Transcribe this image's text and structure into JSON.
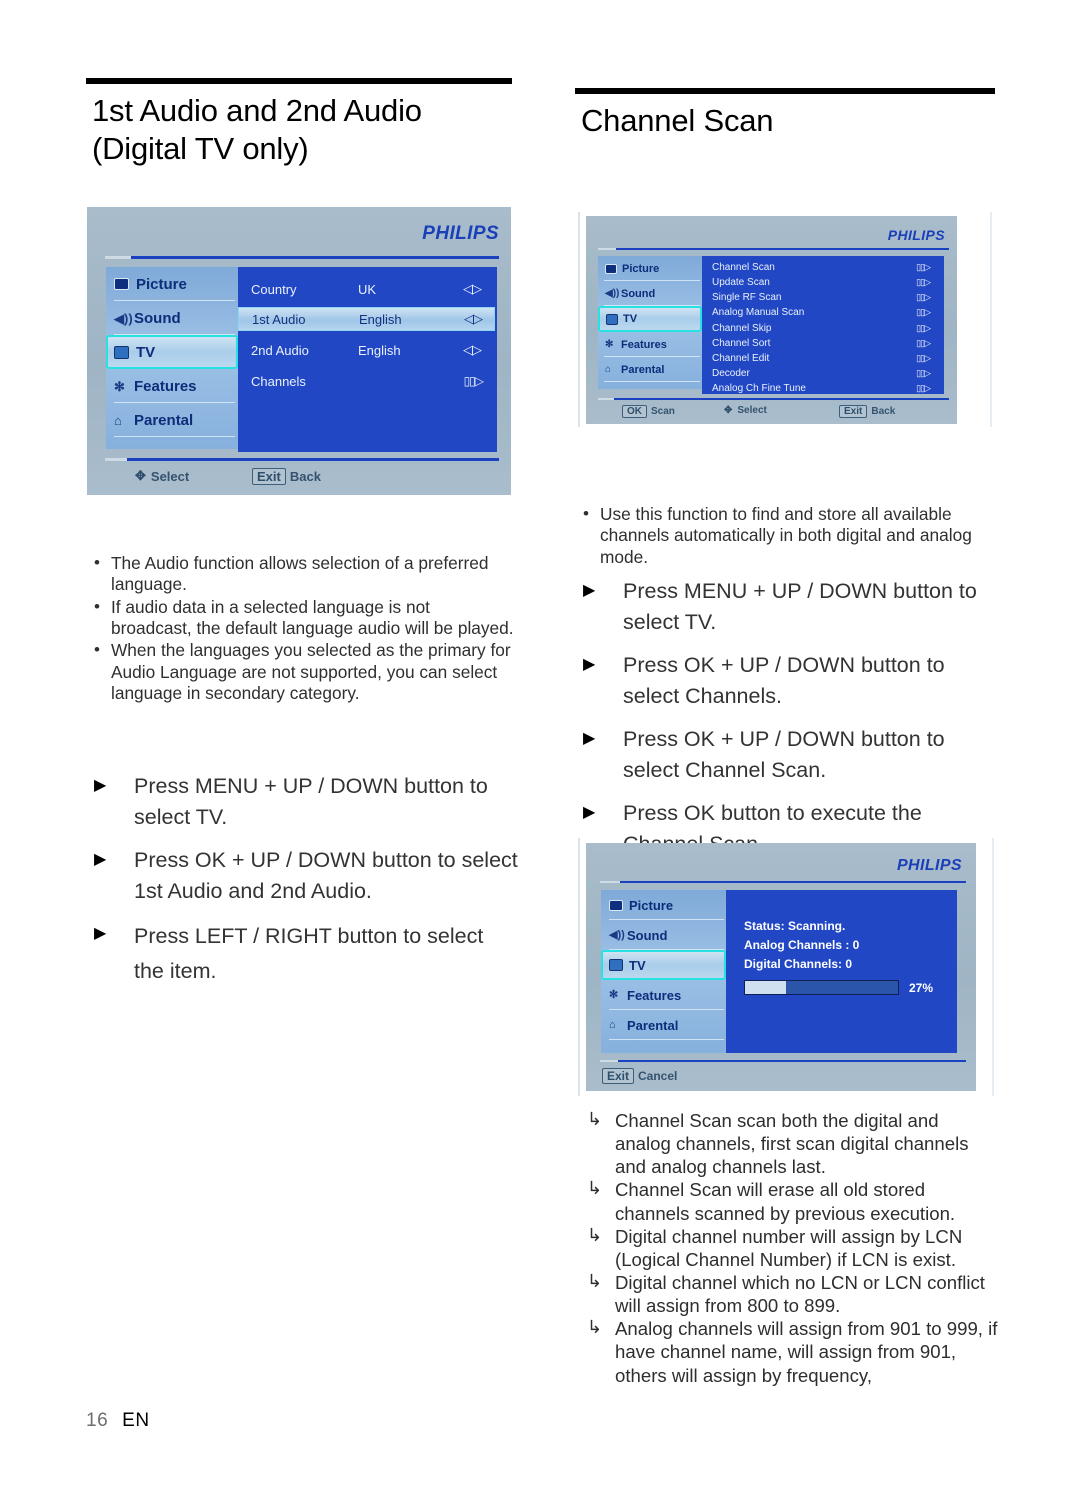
{
  "page": {
    "folio_number": "16",
    "folio_lang": "EN"
  },
  "left_column": {
    "title_line1": "1st Audio and 2nd Audio",
    "title_line2": "(Digital TV only)",
    "bullets": [
      "The Audio function allows selection of a preferred language.",
      "If audio data in a selected language is not broadcast, the default language audio will be played.",
      "When the languages you selected as the primary for Audio Language are not supported, you can select language in secondary category."
    ],
    "steps": [
      "Press MENU + UP / DOWN button to select TV.",
      "Press OK + UP / DOWN button to select 1st Audio and 2nd Audio.",
      "Press LEFT / RIGHT button to select the item."
    ]
  },
  "right_column": {
    "title": "Channel Scan",
    "bullets": [
      "Use this function to find and store all available channels automatically in both digital and analog mode."
    ],
    "steps": [
      "Press MENU + UP / DOWN button to select TV.",
      "Press OK + UP / DOWN button to select Channels.",
      "Press OK + UP / DOWN button to select Channel Scan.",
      "Press OK button to execute the Channel Scan."
    ],
    "notes": [
      "Channel Scan scan both the digital and analog channels, first scan digital channels and analog channels last.",
      "Channel Scan will erase all old stored channels scanned by previous execution.",
      "Digital channel number will assign by LCN (Logical Channel Number) if LCN is exist.",
      "Digital channel which no LCN or LCN conflict will assign from 800 to 899.",
      "Analog channels will assign from 901 to 999, if have channel name, will assign from 901, others will assign by frequency,"
    ]
  },
  "osd_common": {
    "brand": "PHILIPS",
    "nav_items": [
      {
        "label": "Picture",
        "icon": "picture-icon",
        "selected": false
      },
      {
        "label": "Sound",
        "icon": "speaker-icon",
        "selected": false
      },
      {
        "label": "TV",
        "icon": "tv-icon",
        "selected": true
      },
      {
        "label": "Features",
        "icon": "gear-icon",
        "selected": false
      },
      {
        "label": "Parental",
        "icon": "lock-icon",
        "selected": false
      }
    ],
    "colors": {
      "panel_blue": "#2247c4",
      "chrome_gray": "#a4b8c8",
      "brand_blue": "#1b3fb8",
      "highlight_cyan": "#27e2e2"
    }
  },
  "osd_audio": {
    "rows": [
      {
        "label": "Country",
        "value": "UK",
        "arrows": "left-right-arrows",
        "selected": false
      },
      {
        "label": "1st Audio",
        "value": "English",
        "arrows": "left-right-arrows",
        "selected": true
      },
      {
        "label": "2nd Audio",
        "value": "English",
        "arrows": "left-right-arrows",
        "selected": false
      },
      {
        "label": "Channels",
        "value": "",
        "arrows": "submenu-arrow",
        "selected": false
      }
    ],
    "hints": [
      {
        "key": "",
        "pad": "navpad",
        "label": "Select"
      },
      {
        "key": "Exit",
        "pad": "",
        "label": "Back"
      }
    ]
  },
  "osd_channel_menu": {
    "rows": [
      {
        "label": "Channel Scan",
        "arrows": "submenu-arrow"
      },
      {
        "label": "Update Scan",
        "arrows": "submenu-arrow"
      },
      {
        "label": "Single RF Scan",
        "arrows": "submenu-arrow"
      },
      {
        "label": "Analog Manual Scan",
        "arrows": "submenu-arrow"
      },
      {
        "label": "Channel Skip",
        "arrows": "submenu-arrow"
      },
      {
        "label": "Channel Sort",
        "arrows": "submenu-arrow"
      },
      {
        "label": "Channel Edit",
        "arrows": "submenu-arrow"
      },
      {
        "label": "Decoder",
        "arrows": "submenu-arrow"
      },
      {
        "label": "Analog Ch Fine Tune",
        "arrows": "submenu-arrow"
      }
    ],
    "hints": [
      {
        "key": "OK",
        "pad": "",
        "label": "Scan"
      },
      {
        "key": "",
        "pad": "navpad",
        "label": "Select"
      },
      {
        "key": "Exit",
        "pad": "",
        "label": "Back"
      }
    ]
  },
  "osd_scanning": {
    "status": "Status: Scanning.",
    "analog": "Analog Channels : 0",
    "digital": "Digital Channels: 0",
    "progress_percent": 27,
    "progress_label": "27%",
    "hints": [
      {
        "key": "Exit",
        "pad": "",
        "label": "Cancel"
      }
    ]
  }
}
